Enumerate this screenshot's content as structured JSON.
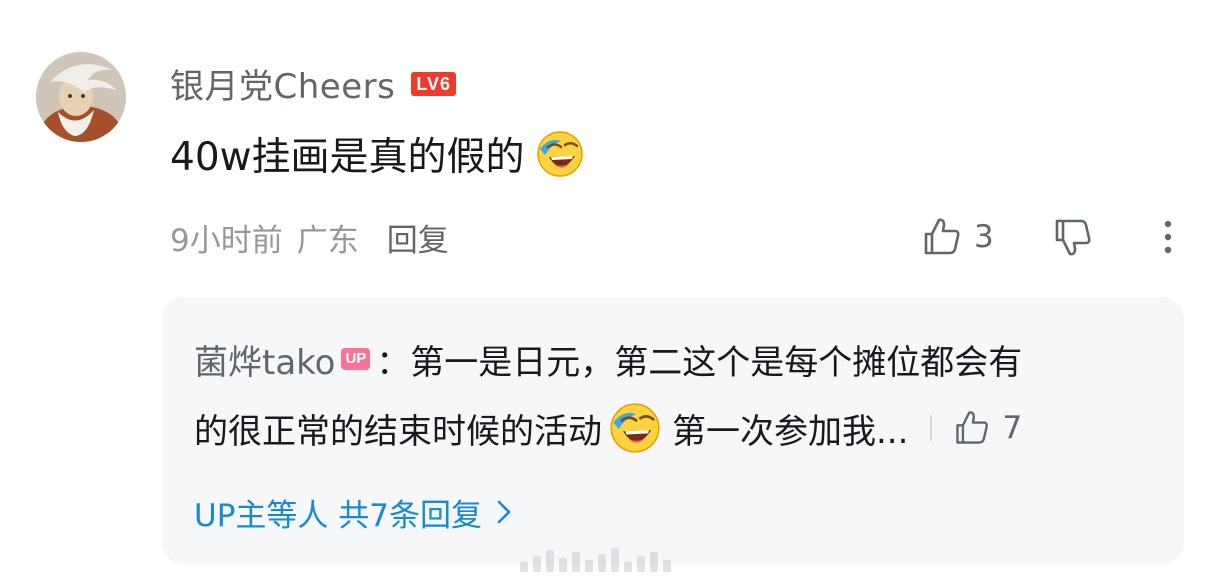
{
  "comment": {
    "username": "银月党Cheers",
    "level": "LV6",
    "text": "40w挂画是真的假的",
    "emoji": "laughing-cry-emoji",
    "time": "9小时前",
    "location": "广东",
    "reply_label": "回复",
    "like_count": "3",
    "icons": {
      "like": "thumbs-up-icon",
      "dislike": "thumbs-down-icon",
      "more": "more-vertical-icon"
    }
  },
  "reply_preview": {
    "username": "菌烨tako",
    "badge": "UP",
    "separator": "：",
    "text_line1": "第一是日元，第二这个是每个摊位都会有",
    "text_line2_a": "的很正常的结束时候的活动",
    "text_line2_b": "第一次参加我...",
    "like_count": "7",
    "summary": "UP主等人 共7条回复",
    "chevron": "chevron-right-icon"
  },
  "colors": {
    "accent_link": "#178bcf",
    "level_badge": "#ef3b2c",
    "up_badge": "#fb7299",
    "muted_text": "#9499a0",
    "secondary_text": "#61666d",
    "reply_bg": "#f6f7f8"
  }
}
